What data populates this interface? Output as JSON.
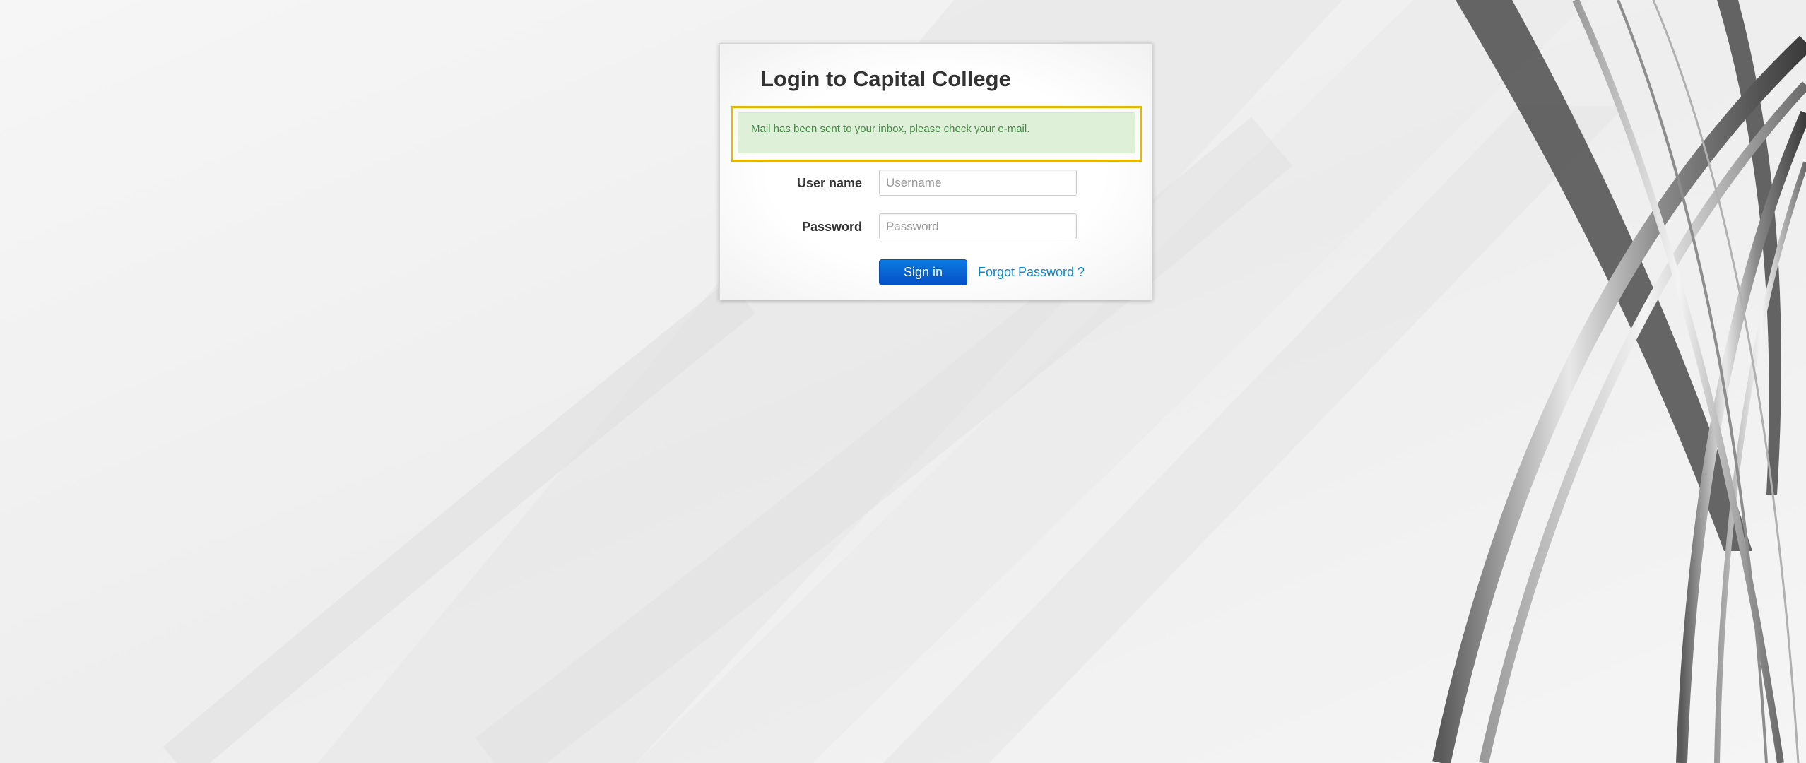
{
  "login": {
    "title": "Login to Capital College",
    "alert_message": "Mail has been sent to your inbox, please check your e-mail.",
    "username_label": "User name",
    "username_placeholder": "Username",
    "username_value": "",
    "password_label": "Password",
    "password_placeholder": "Password",
    "password_value": "",
    "signin_label": "Sign in",
    "forgot_link_label": "Forgot Password ?"
  },
  "colors": {
    "alert_background": "#dff0d8",
    "alert_text": "#468847",
    "highlight_border": "#e5b800",
    "button_blue": "#0650c7",
    "link_blue": "#0b88cc",
    "page_background": "#f3f3f3"
  }
}
